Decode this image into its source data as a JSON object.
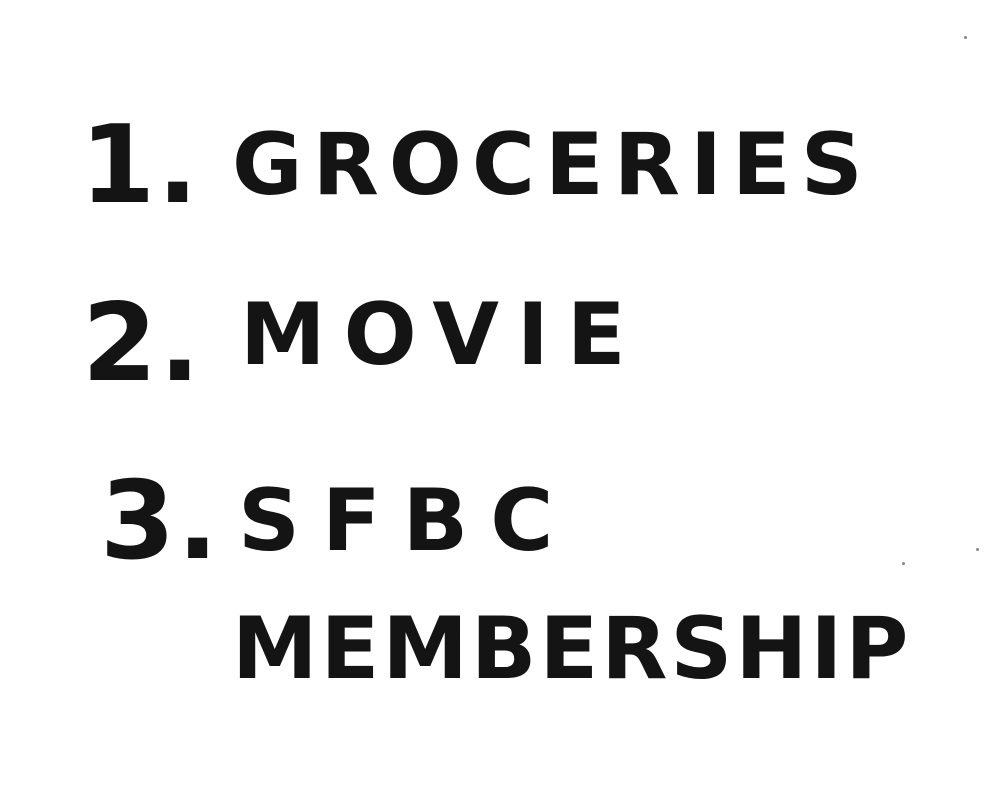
{
  "list": {
    "items": [
      {
        "number": "1.",
        "text": "GROCERIES"
      },
      {
        "number": "2.",
        "text": "MOVIE"
      },
      {
        "number": "3.",
        "text_line1": "SFBC",
        "text_line2": "MEMBERSHIP"
      }
    ]
  }
}
